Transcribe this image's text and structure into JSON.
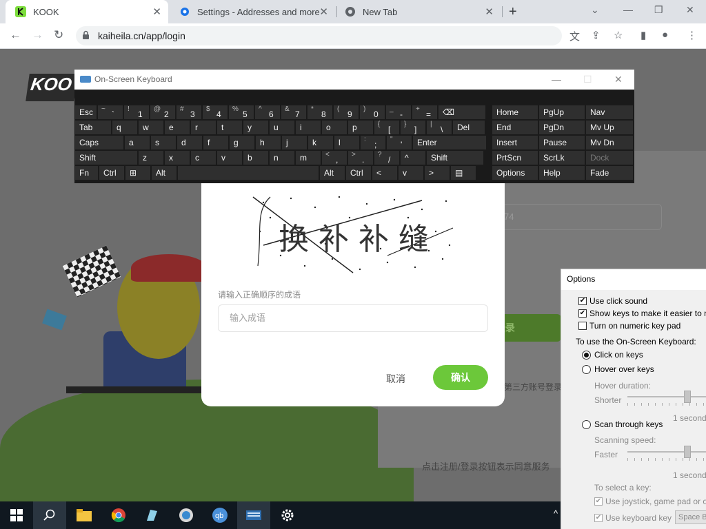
{
  "browser": {
    "tabs": [
      {
        "title": "KOOK",
        "icon": "kook-icon"
      },
      {
        "title": "Settings - Addresses and more",
        "icon": "gear-icon"
      },
      {
        "title": "New Tab",
        "icon": "chrome-icon"
      }
    ],
    "url": "kaiheila.cn/app/login"
  },
  "login": {
    "register_login_btn": "注册/登录",
    "third_party": "第三方账号登录",
    "terms": "点击注册/登录按钮表示同意服务",
    "partial_text": "74"
  },
  "captcha_modal": {
    "captcha_chars": "换 补 补 缝",
    "label": "请输入正确顺序的成语",
    "input_placeholder": "输入成语",
    "cancel": "取消",
    "confirm": "确认"
  },
  "osk": {
    "title": "On-Screen Keyboard",
    "rows": [
      [
        "Esc",
        "~`",
        "!1",
        "@2",
        "#3",
        "$4",
        "%5",
        "^6",
        "&7",
        "*8",
        "(9",
        ")0",
        "_-",
        "+=",
        "⌫"
      ],
      [
        "Tab",
        "q",
        "w",
        "e",
        "r",
        "t",
        "y",
        "u",
        "i",
        "o",
        "p",
        "{[",
        "}]",
        "|\\",
        "Del"
      ],
      [
        "Caps",
        "a",
        "s",
        "d",
        "f",
        "g",
        "h",
        "j",
        "k",
        "l",
        ":;",
        "\"'",
        "Enter"
      ],
      [
        "Shift",
        "z",
        "x",
        "c",
        "v",
        "b",
        "n",
        "m",
        "<,",
        ">.",
        "?/",
        "^",
        "Shift"
      ],
      [
        "Fn",
        "Ctrl",
        "⊞",
        "Alt",
        "",
        "Alt",
        "Ctrl",
        "<",
        "v",
        ">",
        "▤"
      ]
    ],
    "nav_keys": [
      [
        "Home",
        "PgUp",
        "Nav"
      ],
      [
        "End",
        "PgDn",
        "Mv Up"
      ],
      [
        "Insert",
        "Pause",
        "Mv Dn"
      ],
      [
        "PrtScn",
        "ScrLk",
        "Dock"
      ],
      [
        "Options",
        "Help",
        "Fade"
      ]
    ]
  },
  "options": {
    "title": "Options",
    "use_click_sound": "Use click sound",
    "show_keys": "Show keys to make it easier to move",
    "numeric_pad": "Turn on numeric key pad",
    "to_use": "To use the On-Screen Keyboard:",
    "click_on_keys": "Click on keys",
    "hover_over_keys": "Hover over keys",
    "hover_duration": "Hover duration:",
    "shorter": "Shorter",
    "one_second_a": "1 second",
    "scan_through_keys": "Scan through keys",
    "scanning_speed": "Scanning speed:",
    "faster": "Faster",
    "one_second_b": "1 second",
    "to_select": "To select a key:",
    "use_joystick": "Use joystick, game pad or other",
    "use_keyboard_key": "Use keyboard key",
    "space_bar": "Space Bar"
  }
}
